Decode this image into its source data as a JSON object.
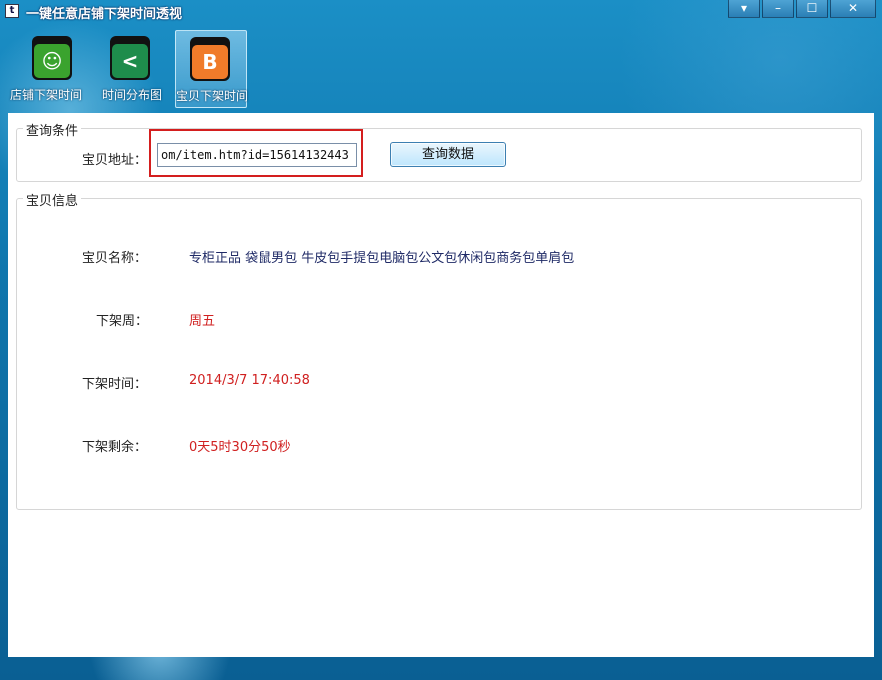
{
  "window": {
    "title": "一键任意店铺下架时间透视",
    "icon_glyph": "t",
    "controls": {
      "extra": "▾",
      "minimize": "–",
      "maximize": "☐",
      "close": "✕"
    }
  },
  "toolbar": {
    "items": [
      {
        "label": "店铺下架时间",
        "icon": "chat-bubble-icon",
        "color": "#3aa32e",
        "glyph": "☺"
      },
      {
        "label": "时间分布图",
        "icon": "share-icon",
        "color": "#1e8c4c",
        "glyph": "<"
      },
      {
        "label": "宝贝下架时间",
        "icon": "blogger-icon",
        "color": "#f07b2a",
        "glyph": "B",
        "active": true
      }
    ]
  },
  "query": {
    "group_title": "查询条件",
    "url_label": "宝贝地址：",
    "url_value": "om/item.htm?id=15614132443",
    "button_label": "查询数据"
  },
  "info": {
    "group_title": "宝贝信息",
    "name_label": "宝贝名称：",
    "name_value": "专柜正品 袋鼠男包 牛皮包手提包电脑包公文包休闲包商务包单肩包",
    "week_label": "下架周：",
    "week_value": "周五",
    "time_label": "下架时间：",
    "time_value": "2014/3/7 17:40:58",
    "remain_label": "下架剩余：",
    "remain_value": "0天5时30分50秒"
  },
  "colors": {
    "accent_red": "#d41e1e",
    "name_value_color": "#1f2a66",
    "value_red": "#d02020"
  }
}
